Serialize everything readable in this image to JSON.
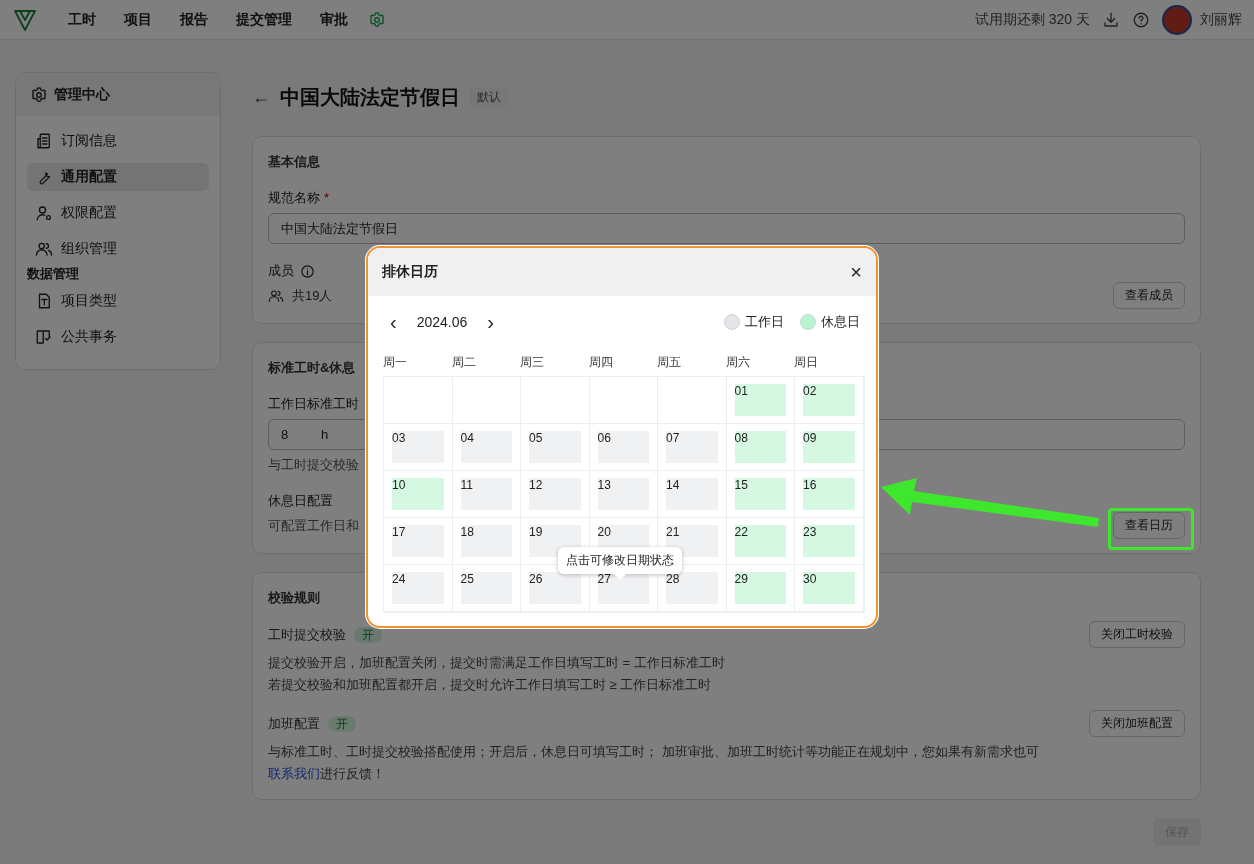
{
  "topbar": {
    "nav": [
      {
        "label": "工时"
      },
      {
        "label": "项目"
      },
      {
        "label": "报告"
      },
      {
        "label": "提交管理"
      },
      {
        "label": "审批"
      }
    ],
    "trial": "试用期还剩 320 天",
    "user": "刘丽辉"
  },
  "sidebar": {
    "title": "管理中心",
    "items": [
      {
        "kind": "item",
        "label": "订阅信息",
        "selected": false
      },
      {
        "kind": "item",
        "label": "通用配置",
        "selected": true
      },
      {
        "kind": "item",
        "label": "权限配置",
        "selected": false
      },
      {
        "kind": "item",
        "label": "组织管理",
        "selected": false
      },
      {
        "kind": "section",
        "label": "数据管理"
      },
      {
        "kind": "item",
        "label": "项目类型",
        "selected": false
      },
      {
        "kind": "item",
        "label": "公共事务",
        "selected": false
      }
    ]
  },
  "page": {
    "back": "←",
    "title": "中国大陆法定节假日",
    "badge": "默认"
  },
  "basic": {
    "title": "基本信息",
    "name_label": "规范名称",
    "required": "*",
    "name_value": "中国大陆法定节假日",
    "members_label": "成员",
    "members_count": "共19人",
    "members_button": "查看成员"
  },
  "standard": {
    "title": "标准工时&休息",
    "hours_label": "工作日标准工时",
    "hours_value": "8",
    "hours_unit": "h",
    "hours_help": "与工时提交校验",
    "rest_label": "休息日配置",
    "rest_desc": "可配置工作日和",
    "calendar_button": "查看日历"
  },
  "rules": {
    "title": "校验规则",
    "items": [
      {
        "label": "工时提交校验",
        "tag": "开",
        "button": "关闭工时校验",
        "lines": [
          "提交校验开启，加班配置关闭，提交时需满足工作日填写工时 = 工作日标准工时",
          "若提交校验和加班配置都开启，提交时允许工作日填写工时 ≥ 工作日标准工时"
        ]
      },
      {
        "label": "加班配置",
        "tag": "开",
        "button": "关闭加班配置",
        "lines": [
          "与标准工时、工时提交校验搭配使用；开启后，休息日可填写工时； 加班审批、加班工时统计等功能正在规划中，您如果有新需求也可"
        ],
        "link": "联系我们",
        "after": "进行反馈！"
      }
    ]
  },
  "save_button": {
    "label": "保存",
    "disabled": true
  },
  "modal": {
    "title": "排休日历",
    "close": "×",
    "prev": "‹",
    "month": "2024.06",
    "next": "›",
    "legend": [
      {
        "label": "工作日",
        "color": "#e3e5e8"
      },
      {
        "label": "休息日",
        "color": "#b6f5cf"
      }
    ],
    "weekdays": [
      "周一",
      "周二",
      "周三",
      "周四",
      "周五",
      "周六",
      "周日"
    ],
    "weeks": [
      [
        {
          "kind": "blank"
        },
        {
          "kind": "blank"
        },
        {
          "kind": "blank"
        },
        {
          "kind": "blank"
        },
        {
          "kind": "blank"
        },
        {
          "day": "01",
          "rest": true
        },
        {
          "day": "02",
          "rest": true
        }
      ],
      [
        {
          "day": "03",
          "rest": false
        },
        {
          "day": "04",
          "rest": false
        },
        {
          "day": "05",
          "rest": false
        },
        {
          "day": "06",
          "rest": false
        },
        {
          "day": "07",
          "rest": false
        },
        {
          "day": "08",
          "rest": true
        },
        {
          "day": "09",
          "rest": true
        }
      ],
      [
        {
          "day": "10",
          "rest": true
        },
        {
          "day": "11",
          "rest": false
        },
        {
          "day": "12",
          "rest": false
        },
        {
          "day": "13",
          "rest": false
        },
        {
          "day": "14",
          "rest": false
        },
        {
          "day": "15",
          "rest": true
        },
        {
          "day": "16",
          "rest": true
        }
      ],
      [
        {
          "day": "17",
          "rest": false
        },
        {
          "day": "18",
          "rest": false
        },
        {
          "day": "19",
          "rest": false
        },
        {
          "day": "20",
          "rest": false
        },
        {
          "day": "21",
          "rest": false
        },
        {
          "day": "22",
          "rest": true
        },
        {
          "day": "23",
          "rest": true
        }
      ],
      [
        {
          "day": "24",
          "rest": false
        },
        {
          "day": "25",
          "rest": false
        },
        {
          "day": "26",
          "rest": false
        },
        {
          "day": "27",
          "rest": false
        },
        {
          "day": "28",
          "rest": false
        },
        {
          "day": "29",
          "rest": true
        },
        {
          "day": "30",
          "rest": true
        }
      ]
    ],
    "tooltip": "点击可修改日期状态"
  }
}
